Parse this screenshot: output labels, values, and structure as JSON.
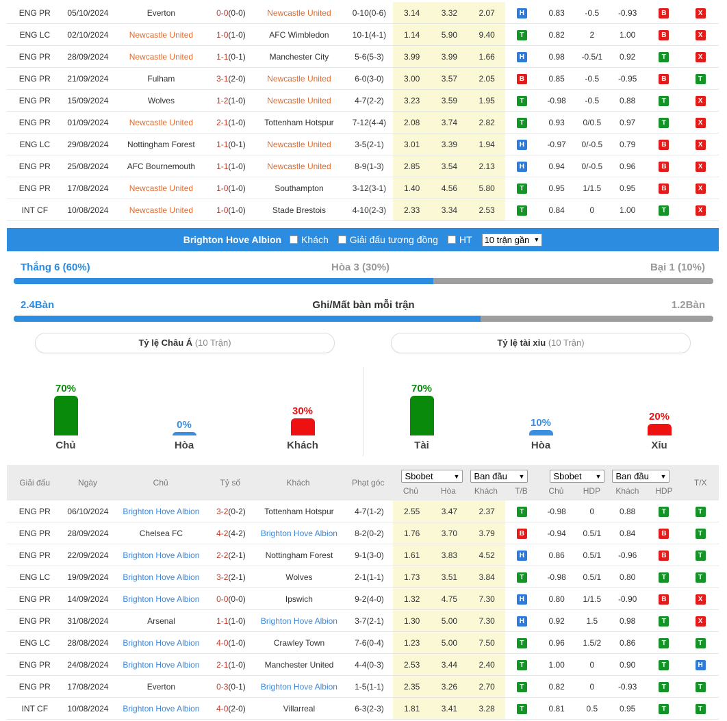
{
  "top_table": [
    {
      "league": "ENG PR",
      "date": "05/10/2024",
      "home": "Everton",
      "home_hl": false,
      "score": "0-0",
      "ht": "(0-0)",
      "away": "Newcastle United",
      "away_hl": true,
      "corner": "0-10(0-6)",
      "o1": "3.14",
      "o2": "3.32",
      "o3": "2.07",
      "tb": "H",
      "a1": "0.83",
      "a2": "-0.5",
      "a3": "-0.93",
      "hdp": "B",
      "tx": "X"
    },
    {
      "league": "ENG LC",
      "date": "02/10/2024",
      "home": "Newcastle United",
      "home_hl": true,
      "score": "1-0",
      "ht": "(1-0)",
      "away": "AFC Wimbledon",
      "away_hl": false,
      "corner": "10-1(4-1)",
      "o1": "1.14",
      "o2": "5.90",
      "o3": "9.40",
      "tb": "T",
      "a1": "0.82",
      "a2": "2",
      "a3": "1.00",
      "hdp": "B",
      "tx": "X"
    },
    {
      "league": "ENG PR",
      "date": "28/09/2024",
      "home": "Newcastle United",
      "home_hl": true,
      "score": "1-1",
      "ht": "(0-1)",
      "away": "Manchester City",
      "away_hl": false,
      "corner": "5-6(5-3)",
      "o1": "3.99",
      "o2": "3.99",
      "o3": "1.66",
      "tb": "H",
      "a1": "0.98",
      "a2": "-0.5/1",
      "a3": "0.92",
      "hdp": "T",
      "tx": "X"
    },
    {
      "league": "ENG PR",
      "date": "21/09/2024",
      "home": "Fulham",
      "home_hl": false,
      "score": "3-1",
      "ht": "(2-0)",
      "away": "Newcastle United",
      "away_hl": true,
      "corner": "6-0(3-0)",
      "o1": "3.00",
      "o2": "3.57",
      "o3": "2.05",
      "tb": "B",
      "a1": "0.85",
      "a2": "-0.5",
      "a3": "-0.95",
      "hdp": "B",
      "tx": "T"
    },
    {
      "league": "ENG PR",
      "date": "15/09/2024",
      "home": "Wolves",
      "home_hl": false,
      "score": "1-2",
      "ht": "(1-0)",
      "away": "Newcastle United",
      "away_hl": true,
      "corner": "4-7(2-2)",
      "o1": "3.23",
      "o2": "3.59",
      "o3": "1.95",
      "tb": "T",
      "a1": "-0.98",
      "a2": "-0.5",
      "a3": "0.88",
      "hdp": "T",
      "tx": "X"
    },
    {
      "league": "ENG PR",
      "date": "01/09/2024",
      "home": "Newcastle United",
      "home_hl": true,
      "score": "2-1",
      "ht": "(1-0)",
      "away": "Tottenham Hotspur",
      "away_hl": false,
      "corner": "7-12(4-4)",
      "o1": "2.08",
      "o2": "3.74",
      "o3": "2.82",
      "tb": "T",
      "a1": "0.93",
      "a2": "0/0.5",
      "a3": "0.97",
      "hdp": "T",
      "tx": "X"
    },
    {
      "league": "ENG LC",
      "date": "29/08/2024",
      "home": "Nottingham Forest",
      "home_hl": false,
      "score": "1-1",
      "ht": "(0-1)",
      "away": "Newcastle United",
      "away_hl": true,
      "corner": "3-5(2-1)",
      "o1": "3.01",
      "o2": "3.39",
      "o3": "1.94",
      "tb": "H",
      "a1": "-0.97",
      "a2": "0/-0.5",
      "a3": "0.79",
      "hdp": "B",
      "tx": "X"
    },
    {
      "league": "ENG PR",
      "date": "25/08/2024",
      "home": "AFC Bournemouth",
      "home_hl": false,
      "score": "1-1",
      "ht": "(1-0)",
      "away": "Newcastle United",
      "away_hl": true,
      "corner": "8-9(1-3)",
      "o1": "2.85",
      "o2": "3.54",
      "o3": "2.13",
      "tb": "H",
      "a1": "0.94",
      "a2": "0/-0.5",
      "a3": "0.96",
      "hdp": "B",
      "tx": "X"
    },
    {
      "league": "ENG PR",
      "date": "17/08/2024",
      "home": "Newcastle United",
      "home_hl": true,
      "score": "1-0",
      "ht": "(1-0)",
      "away": "Southampton",
      "away_hl": false,
      "corner": "3-12(3-1)",
      "o1": "1.40",
      "o2": "4.56",
      "o3": "5.80",
      "tb": "T",
      "a1": "0.95",
      "a2": "1/1.5",
      "a3": "0.95",
      "hdp": "B",
      "tx": "X"
    },
    {
      "league": "INT CF",
      "date": "10/08/2024",
      "home": "Newcastle United",
      "home_hl": true,
      "score": "1-0",
      "ht": "(1-0)",
      "away": "Stade Brestois",
      "away_hl": false,
      "corner": "4-10(2-3)",
      "o1": "2.33",
      "o2": "3.34",
      "o3": "2.53",
      "tb": "T",
      "a1": "0.84",
      "a2": "0",
      "a3": "1.00",
      "hdp": "T",
      "tx": "X"
    }
  ],
  "filter": {
    "team": "Brighton Hove Albion",
    "opt_away": "Khách",
    "opt_same_league": "Giải đấu tương đồng",
    "opt_ht": "HT",
    "match_count": "10 trận gần"
  },
  "stats": {
    "win": "Thắng 6 (60%)",
    "draw": "Hòa 3 (30%)",
    "loss": "Bại 1 (10%)",
    "win_fraction": 0.6,
    "goals_for": "2.4Bàn",
    "goals_title": "Ghi/Mất bàn mỗi trận",
    "goals_against": "1.2Bàn",
    "goals_fraction": 0.667
  },
  "asian": {
    "title": "Tỷ lệ Châu Á",
    "sub": "(10 Trận)",
    "items": [
      {
        "pct": "70%",
        "value": 70,
        "label": "Chủ",
        "color": "#0a8a0a"
      },
      {
        "pct": "0%",
        "value": 0,
        "label": "Hòa",
        "color": "#3a8ee0"
      },
      {
        "pct": "30%",
        "value": 30,
        "label": "Khách",
        "color": "#ee1111"
      }
    ]
  },
  "overunder": {
    "title": "Tỷ lệ tài xỉu",
    "sub": "(10 Trận)",
    "items": [
      {
        "pct": "70%",
        "value": 70,
        "label": "Tài",
        "color": "#0a8a0a"
      },
      {
        "pct": "10%",
        "value": 10,
        "label": "Hòa",
        "color": "#3a8ee0"
      },
      {
        "pct": "20%",
        "value": 20,
        "label": "Xỉu",
        "color": "#ee1111"
      }
    ]
  },
  "header": {
    "league": "Giải đấu",
    "date": "Ngày",
    "home": "Chủ",
    "score": "Tỷ số",
    "away": "Khách",
    "corner": "Phạt góc",
    "sel1": "Sbobet",
    "sel2": "Ban đầu",
    "sel3": "Sbobet",
    "sel4": "Ban đầu",
    "o1": "Chủ",
    "o2": "Hòa",
    "o3": "Khách",
    "tb": "T/B",
    "a1": "Chủ",
    "a2": "HDP",
    "a3": "Khách",
    "hdp": "HDP",
    "tx": "T/X"
  },
  "bottom_table": [
    {
      "league": "ENG PR",
      "date": "06/10/2024",
      "home": "Brighton Hove Albion",
      "home_hl": true,
      "score": "3-2",
      "ht": "(0-2)",
      "away": "Tottenham Hotspur",
      "away_hl": false,
      "corner": "4-7(1-2)",
      "o1": "2.55",
      "o2": "3.47",
      "o3": "2.37",
      "tb": "T",
      "a1": "-0.98",
      "a2": "0",
      "a3": "0.88",
      "hdp": "T",
      "tx": "T"
    },
    {
      "league": "ENG PR",
      "date": "28/09/2024",
      "home": "Chelsea FC",
      "home_hl": false,
      "score": "4-2",
      "ht": "(4-2)",
      "away": "Brighton Hove Albion",
      "away_hl": true,
      "corner": "8-2(0-2)",
      "o1": "1.76",
      "o2": "3.70",
      "o3": "3.79",
      "tb": "B",
      "a1": "-0.94",
      "a2": "0.5/1",
      "a3": "0.84",
      "hdp": "B",
      "tx": "T"
    },
    {
      "league": "ENG PR",
      "date": "22/09/2024",
      "home": "Brighton Hove Albion",
      "home_hl": true,
      "score": "2-2",
      "ht": "(2-1)",
      "away": "Nottingham Forest",
      "away_hl": false,
      "corner": "9-1(3-0)",
      "o1": "1.61",
      "o2": "3.83",
      "o3": "4.52",
      "tb": "H",
      "a1": "0.86",
      "a2": "0.5/1",
      "a3": "-0.96",
      "hdp": "B",
      "tx": "T"
    },
    {
      "league": "ENG LC",
      "date": "19/09/2024",
      "home": "Brighton Hove Albion",
      "home_hl": true,
      "score": "3-2",
      "ht": "(2-1)",
      "away": "Wolves",
      "away_hl": false,
      "corner": "2-1(1-1)",
      "o1": "1.73",
      "o2": "3.51",
      "o3": "3.84",
      "tb": "T",
      "a1": "-0.98",
      "a2": "0.5/1",
      "a3": "0.80",
      "hdp": "T",
      "tx": "T"
    },
    {
      "league": "ENG PR",
      "date": "14/09/2024",
      "home": "Brighton Hove Albion",
      "home_hl": true,
      "score": "0-0",
      "ht": "(0-0)",
      "away": "Ipswich",
      "away_hl": false,
      "corner": "9-2(4-0)",
      "o1": "1.32",
      "o2": "4.75",
      "o3": "7.30",
      "tb": "H",
      "a1": "0.80",
      "a2": "1/1.5",
      "a3": "-0.90",
      "hdp": "B",
      "tx": "X"
    },
    {
      "league": "ENG PR",
      "date": "31/08/2024",
      "home": "Arsenal",
      "home_hl": false,
      "score": "1-1",
      "ht": "(1-0)",
      "away": "Brighton Hove Albion",
      "away_hl": true,
      "corner": "3-7(2-1)",
      "o1": "1.30",
      "o2": "5.00",
      "o3": "7.30",
      "tb": "H",
      "a1": "0.92",
      "a2": "1.5",
      "a3": "0.98",
      "hdp": "T",
      "tx": "X"
    },
    {
      "league": "ENG LC",
      "date": "28/08/2024",
      "home": "Brighton Hove Albion",
      "home_hl": true,
      "score": "4-0",
      "ht": "(1-0)",
      "away": "Crawley Town",
      "away_hl": false,
      "corner": "7-6(0-4)",
      "o1": "1.23",
      "o2": "5.00",
      "o3": "7.50",
      "tb": "T",
      "a1": "0.96",
      "a2": "1.5/2",
      "a3": "0.86",
      "hdp": "T",
      "tx": "T"
    },
    {
      "league": "ENG PR",
      "date": "24/08/2024",
      "home": "Brighton Hove Albion",
      "home_hl": true,
      "score": "2-1",
      "ht": "(1-0)",
      "away": "Manchester United",
      "away_hl": false,
      "corner": "4-4(0-3)",
      "o1": "2.53",
      "o2": "3.44",
      "o3": "2.40",
      "tb": "T",
      "a1": "1.00",
      "a2": "0",
      "a3": "0.90",
      "hdp": "T",
      "tx": "H"
    },
    {
      "league": "ENG PR",
      "date": "17/08/2024",
      "home": "Everton",
      "home_hl": false,
      "score": "0-3",
      "ht": "(0-1)",
      "away": "Brighton Hove Albion",
      "away_hl": true,
      "corner": "1-5(1-1)",
      "o1": "2.35",
      "o2": "3.26",
      "o3": "2.70",
      "tb": "T",
      "a1": "0.82",
      "a2": "0",
      "a3": "-0.93",
      "hdp": "T",
      "tx": "T"
    },
    {
      "league": "INT CF",
      "date": "10/08/2024",
      "home": "Brighton Hove Albion",
      "home_hl": true,
      "score": "4-0",
      "ht": "(2-0)",
      "away": "Villarreal",
      "away_hl": false,
      "corner": "6-3(2-3)",
      "o1": "1.81",
      "o2": "3.41",
      "o3": "3.28",
      "tb": "T",
      "a1": "0.81",
      "a2": "0.5",
      "a3": "0.95",
      "hdp": "T",
      "tx": "T"
    }
  ]
}
